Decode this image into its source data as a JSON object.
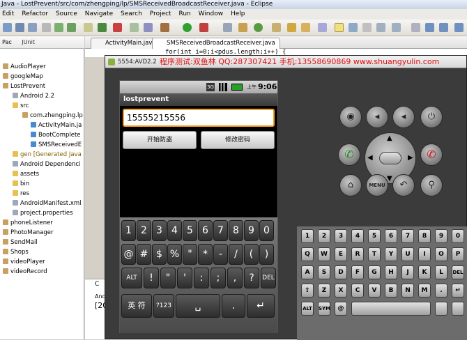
{
  "window": {
    "title": "Java - LostPrevent/src/com/zhengping/lp/SMSReceivedBroadcastReceiver.java - Eclipse"
  },
  "menu": [
    "Edit",
    "Refactor",
    "Source",
    "Navigate",
    "Search",
    "Project",
    "Run",
    "Window",
    "Help"
  ],
  "explorer": {
    "tabs": [
      "Pac",
      "JUnit"
    ],
    "items": [
      "AudioPlayer",
      "googleMap",
      "LostPrevent",
      "Android 2.2",
      "src",
      "com.zhengping.lp",
      "ActivityMain.ja",
      "BootComplete",
      "SMSReceivedE",
      "gen [Generated Java",
      "Android Dependenci",
      "assets",
      "bin",
      "res",
      "AndroidManifest.xml",
      "project.properties",
      "phoneListener",
      "PhotoManager",
      "SendMail",
      "Shops",
      "videoPlayer",
      "videoRecord"
    ]
  },
  "editor": {
    "tabs": [
      "ActivityMain.java",
      "SMSReceivedBroadcastReceiver.java"
    ],
    "code_line": "for(int i=0;i<pdus.length;i++) {"
  },
  "console": {
    "label": "C",
    "line1": "Andr",
    "line2": "[20"
  },
  "emulator": {
    "window_name": "5554:AVD2.2",
    "banner": "程序测试:双鱼林 QQ:287307421 手机:13558690869 www.shuangyulin.com",
    "status": {
      "network": "3G",
      "time_prefix": "上午",
      "time": "9:06"
    },
    "app_title": "lostprevent",
    "phone_input": "15555215556",
    "buttons": [
      "开始防盗",
      "修改密码"
    ]
  },
  "soft_keyboard": {
    "row1": [
      "1",
      "2",
      "3",
      "4",
      "5",
      "6",
      "7",
      "8",
      "9",
      "0"
    ],
    "row2": [
      "@",
      "#",
      "$",
      "%",
      "\"",
      "*",
      "-",
      "/",
      "(",
      ")"
    ],
    "row3": [
      "ALT",
      "!",
      "\"",
      "'",
      ":",
      ";",
      ",",
      "?",
      "DEL"
    ],
    "row4": [
      "英 符",
      "?123",
      "␣",
      ".",
      "↵"
    ]
  },
  "controls": {
    "top": [
      "camera-icon",
      "volume-down-icon",
      "volume-up-icon",
      "power-icon"
    ],
    "bottom": [
      "home-icon",
      "MENU",
      "back-icon",
      "search-icon"
    ]
  },
  "hw_keyboard": {
    "row1": [
      "1",
      "2",
      "3",
      "4",
      "5",
      "6",
      "7",
      "8",
      "9",
      "0"
    ],
    "row2": [
      "Q",
      "W",
      "E",
      "R",
      "T",
      "Y",
      "U",
      "I",
      "O",
      "P"
    ],
    "row3": [
      "A",
      "S",
      "D",
      "F",
      "G",
      "H",
      "J",
      "K",
      "L",
      "DEL"
    ],
    "row4": [
      "⇧",
      "Z",
      "X",
      "C",
      "V",
      "B",
      "N",
      "M",
      ".",
      "↵"
    ],
    "row5": [
      "ALT",
      "SYM",
      "@",
      "",
      ""
    ]
  }
}
